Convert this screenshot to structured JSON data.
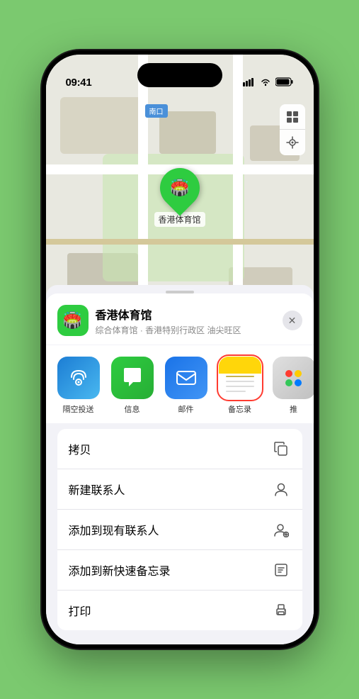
{
  "status_bar": {
    "time": "09:41",
    "signal": "▌▌▌",
    "wifi": "WiFi",
    "battery": "Battery"
  },
  "map": {
    "label": "南口",
    "pin_label": "香港体育馆"
  },
  "venue_sheet": {
    "name": "香港体育馆",
    "description": "综合体育馆 · 香港特别行政区 油尖旺区",
    "close_label": "×"
  },
  "apps": [
    {
      "id": "airdrop",
      "label": "隔空投送",
      "type": "airdrop"
    },
    {
      "id": "messages",
      "label": "信息",
      "type": "messages"
    },
    {
      "id": "mail",
      "label": "邮件",
      "type": "mail"
    },
    {
      "id": "notes",
      "label": "备忘录",
      "type": "notes",
      "selected": true
    },
    {
      "id": "more",
      "label": "推",
      "type": "more"
    }
  ],
  "menu_items": [
    {
      "id": "copy",
      "label": "拷贝",
      "icon": "copy"
    },
    {
      "id": "new-contact",
      "label": "新建联系人",
      "icon": "person"
    },
    {
      "id": "add-existing",
      "label": "添加到现有联系人",
      "icon": "person-add"
    },
    {
      "id": "add-notes",
      "label": "添加到新快速备忘录",
      "icon": "note"
    },
    {
      "id": "print",
      "label": "打印",
      "icon": "print"
    }
  ]
}
